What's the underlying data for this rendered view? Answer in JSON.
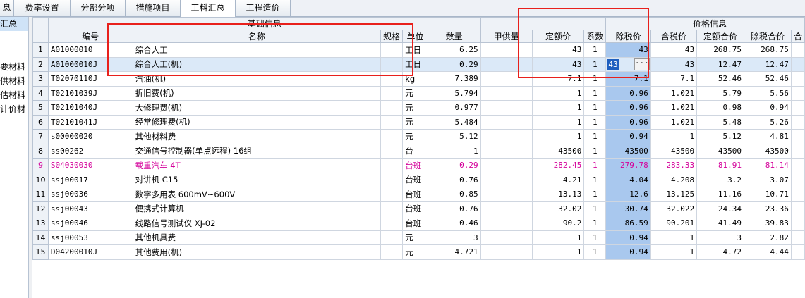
{
  "tabs": [
    "息",
    "费率设置",
    "分部分项",
    "措施项目",
    "工料汇总",
    "工程造价"
  ],
  "sidebar": [
    "汇总",
    "",
    "",
    "要材料",
    "供材料",
    "估材料",
    "计价材"
  ],
  "groups": {
    "basic": "基础信息",
    "price": "价格信息"
  },
  "columns": [
    "编号",
    "名称",
    "规格",
    "单位",
    "数量",
    "甲供量",
    "定额价",
    "系数",
    "除税价",
    "含税价",
    "定额合价",
    "除税合价",
    "合"
  ],
  "rows": [
    {
      "no": "1",
      "code": "A01000010",
      "name": "综合人工",
      "spec": "",
      "unit": "工日",
      "qty": "6.25",
      "jgl": "",
      "dej": "43",
      "xs": "1",
      "csj": "43",
      "hsj": "43",
      "dehj": "268.75",
      "cshj": "268.75"
    },
    {
      "no": "2",
      "code": "A01000010J",
      "name": "综合人工(机)",
      "spec": "",
      "unit": "工日",
      "qty": "0.29",
      "jgl": "",
      "dej": "43",
      "xs": "1",
      "csj": "43",
      "hsj": "43",
      "dehj": "12.47",
      "cshj": "12.47"
    },
    {
      "no": "3",
      "code": "T02070110J",
      "name": "汽油(机)",
      "spec": "",
      "unit": "kg",
      "qty": "7.389",
      "jgl": "",
      "dej": "7.1",
      "xs": "1",
      "csj": "7.1",
      "hsj": "7.1",
      "dehj": "52.46",
      "cshj": "52.46"
    },
    {
      "no": "4",
      "code": "T02101039J",
      "name": "折旧费(机)",
      "spec": "",
      "unit": "元",
      "qty": "5.794",
      "jgl": "",
      "dej": "1",
      "xs": "1",
      "csj": "0.96",
      "hsj": "1.021",
      "dehj": "5.79",
      "cshj": "5.56"
    },
    {
      "no": "5",
      "code": "T02101040J",
      "name": "大修理费(机)",
      "spec": "",
      "unit": "元",
      "qty": "0.977",
      "jgl": "",
      "dej": "1",
      "xs": "1",
      "csj": "0.96",
      "hsj": "1.021",
      "dehj": "0.98",
      "cshj": "0.94"
    },
    {
      "no": "6",
      "code": "T02101041J",
      "name": "经常修理费(机)",
      "spec": "",
      "unit": "元",
      "qty": "5.484",
      "jgl": "",
      "dej": "1",
      "xs": "1",
      "csj": "0.96",
      "hsj": "1.021",
      "dehj": "5.48",
      "cshj": "5.26"
    },
    {
      "no": "7",
      "code": "s00000020",
      "name": "其他材料费",
      "spec": "",
      "unit": "元",
      "qty": "5.12",
      "jgl": "",
      "dej": "1",
      "xs": "1",
      "csj": "0.94",
      "hsj": "1",
      "dehj": "5.12",
      "cshj": "4.81"
    },
    {
      "no": "8",
      "code": "ss00262",
      "name": "交通信号控制器(单点远程) 16组",
      "spec": "",
      "unit": "台",
      "qty": "1",
      "jgl": "",
      "dej": "43500",
      "xs": "1",
      "csj": "43500",
      "hsj": "43500",
      "dehj": "43500",
      "cshj": "43500"
    },
    {
      "no": "9",
      "code": "S04030030",
      "name": "载重汽车 4T",
      "spec": "",
      "unit": "台班",
      "qty": "0.29",
      "jgl": "",
      "dej": "282.45",
      "xs": "1",
      "csj": "279.78",
      "hsj": "283.33",
      "dehj": "81.91",
      "cshj": "81.14"
    },
    {
      "no": "10",
      "code": "ssj00017",
      "name": "对讲机 C15",
      "spec": "",
      "unit": "台班",
      "qty": "0.76",
      "jgl": "",
      "dej": "4.21",
      "xs": "1",
      "csj": "4.04",
      "hsj": "4.208",
      "dehj": "3.2",
      "cshj": "3.07"
    },
    {
      "no": "11",
      "code": "ssj00036",
      "name": "数字多用表 600mV~600V",
      "spec": "",
      "unit": "台班",
      "qty": "0.85",
      "jgl": "",
      "dej": "13.13",
      "xs": "1",
      "csj": "12.6",
      "hsj": "13.125",
      "dehj": "11.16",
      "cshj": "10.71"
    },
    {
      "no": "12",
      "code": "ssj00043",
      "name": "便携式计算机",
      "spec": "",
      "unit": "台班",
      "qty": "0.76",
      "jgl": "",
      "dej": "32.02",
      "xs": "1",
      "csj": "30.74",
      "hsj": "32.022",
      "dehj": "24.34",
      "cshj": "23.36"
    },
    {
      "no": "13",
      "code": "ssj00046",
      "name": "线路信号测试仪 XJ-02",
      "spec": "",
      "unit": "台班",
      "qty": "0.46",
      "jgl": "",
      "dej": "90.2",
      "xs": "1",
      "csj": "86.59",
      "hsj": "90.201",
      "dehj": "41.49",
      "cshj": "39.83"
    },
    {
      "no": "14",
      "code": "ssj00053",
      "name": "其他机具费",
      "spec": "",
      "unit": "元",
      "qty": "3",
      "jgl": "",
      "dej": "1",
      "xs": "1",
      "csj": "0.94",
      "hsj": "1",
      "dehj": "3",
      "cshj": "2.82"
    },
    {
      "no": "15",
      "code": "D04200010J",
      "name": "其他费用(机)",
      "spec": "",
      "unit": "元",
      "qty": "4.721",
      "jgl": "",
      "dej": "1",
      "xs": "1",
      "csj": "0.94",
      "hsj": "1",
      "dehj": "4.72",
      "cshj": "4.44"
    }
  ],
  "editing": {
    "value": "43",
    "button": "···"
  },
  "colors": {
    "highlight": "#a9c8ee",
    "selected": "#dbe9f8",
    "pink": "#d4009a",
    "annotation": "#e8201c"
  }
}
